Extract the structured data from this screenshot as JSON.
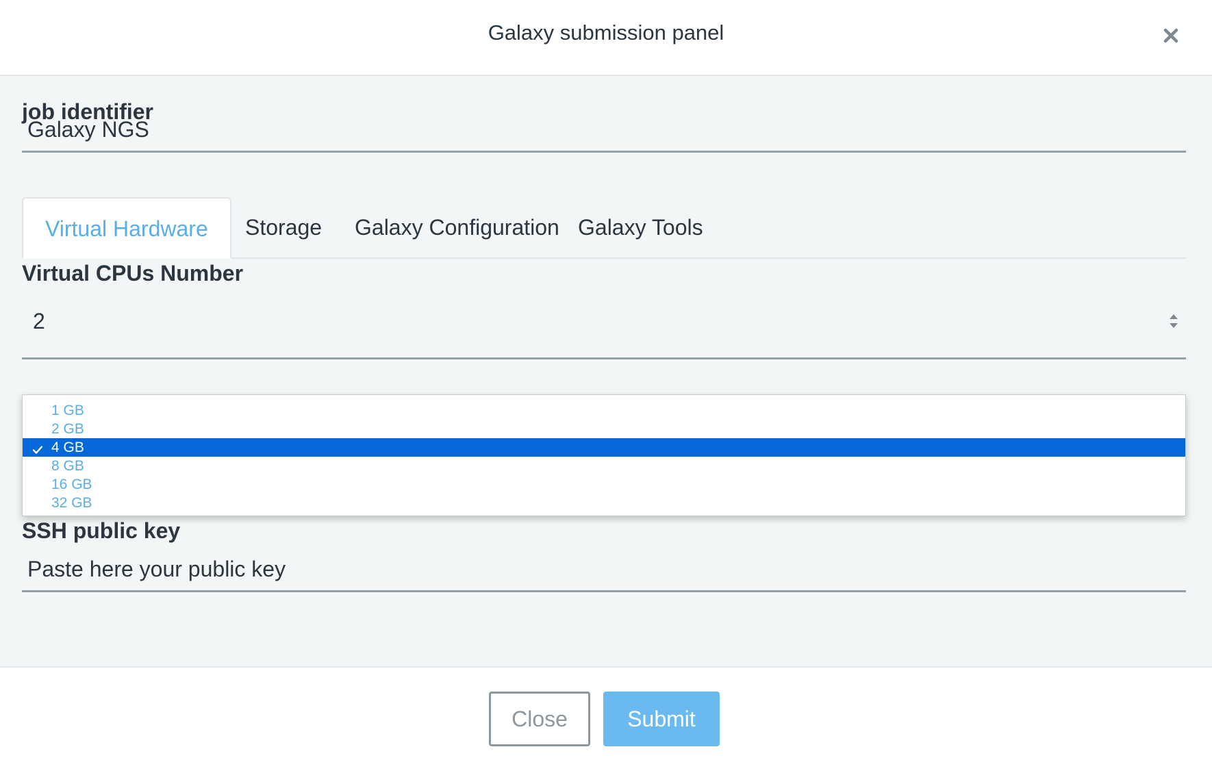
{
  "dialog": {
    "title": "Galaxy submission panel"
  },
  "job_identifier": {
    "label": "job identifier",
    "value": "Galaxy NGS"
  },
  "tabs": [
    {
      "label": "Virtual Hardware",
      "active": true
    },
    {
      "label": "Storage",
      "active": false
    },
    {
      "label": "Galaxy Configuration",
      "active": false
    },
    {
      "label": "Galaxy Tools",
      "active": false
    }
  ],
  "vcpus": {
    "label": "Virtual CPUs Number",
    "value": "2"
  },
  "memory_dropdown": {
    "options": [
      "1 GB",
      "2 GB",
      "4 GB",
      "8 GB",
      "16 GB",
      "32 GB"
    ],
    "selected": "4 GB"
  },
  "ssh_key": {
    "label": "SSH public key",
    "placeholder": "Paste here your public key"
  },
  "footer": {
    "close_label": "Close",
    "submit_label": "Submit"
  },
  "colors": {
    "accent": "#5aaee6",
    "selected_option": "#0568d8",
    "submit_button": "#6ab9ef",
    "body_background": "#f3f6f7"
  }
}
